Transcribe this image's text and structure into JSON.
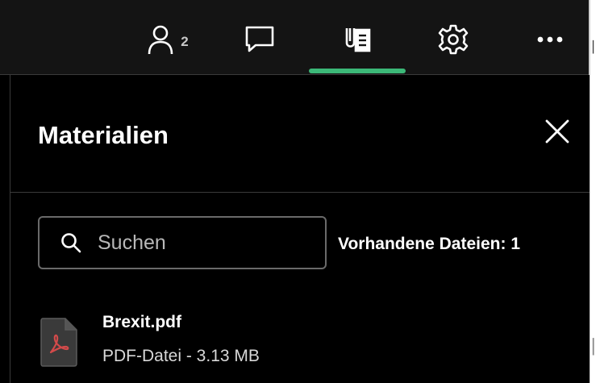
{
  "topbar": {
    "participants": {
      "icon": "person-icon",
      "count": "2"
    },
    "chat": {
      "icon": "chat-bubble-icon"
    },
    "materials": {
      "icon": "materials-icon",
      "active": true
    },
    "settings": {
      "icon": "gear-icon"
    },
    "more": {
      "icon": "more-horizontal-icon"
    },
    "accent_color": "#3cb878"
  },
  "panel": {
    "title": "Materialien",
    "close_icon": "close-icon"
  },
  "search": {
    "placeholder": "Suchen",
    "value": "",
    "icon": "search-icon"
  },
  "files": {
    "count_label": "Vorhandene Dateien: 1",
    "items": [
      {
        "name": "Brexit.pdf",
        "meta": "PDF-Datei - 3.13 MB",
        "icon": "pdf-file-icon",
        "icon_color": "#d24a4a"
      }
    ]
  }
}
